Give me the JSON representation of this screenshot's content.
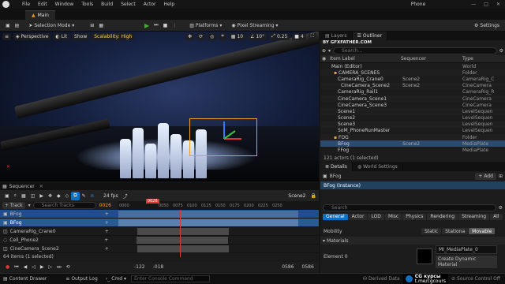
{
  "app": {
    "logo": "unreal-logo",
    "level_tab": "Main",
    "project": "Phone"
  },
  "menu": [
    "File",
    "Edit",
    "Window",
    "Tools",
    "Build",
    "Select",
    "Actor",
    "Help"
  ],
  "toolbar": {
    "mode": "Selection Mode",
    "platforms": "Platforms",
    "pixel_streaming": "Pixel Streaming",
    "settings": "Settings"
  },
  "viewport": {
    "perspective": "Perspective",
    "lit": "Lit",
    "show": "Show",
    "scalability": "Scalability: High",
    "snap_grid": "10",
    "snap_rot": "10°",
    "snap_scale": "0.25",
    "cam_speed": "4"
  },
  "outliner": {
    "tabs": [
      "Layers",
      "Outliner"
    ],
    "watermark": "BY GFXFATHER.COM",
    "search_placeholder": "Search...",
    "columns": [
      "Item Label",
      "Sequencer",
      "Type"
    ],
    "rows": [
      {
        "label": "Main (Editor)",
        "seq": "",
        "type": "World"
      },
      {
        "label": "CAMERA_SCENES",
        "seq": "",
        "type": "Folder"
      },
      {
        "label": "CameraRig_Crane0",
        "seq": "Scene2",
        "type": "CameraRig_C"
      },
      {
        "label": "CineCamera_Scene2",
        "seq": "Scene2",
        "type": "CineCamera"
      },
      {
        "label": "CameraRig_Rail1",
        "seq": "",
        "type": "CameraRig_R"
      },
      {
        "label": "CineCamera_Scene1",
        "seq": "",
        "type": "CineCamera"
      },
      {
        "label": "CineCamera_Scene3",
        "seq": "",
        "type": "CineCamera"
      },
      {
        "label": "Scene1",
        "seq": "",
        "type": "LevelSequen"
      },
      {
        "label": "Scene2",
        "seq": "",
        "type": "LevelSequen"
      },
      {
        "label": "Scene3",
        "seq": "",
        "type": "LevelSequen"
      },
      {
        "label": "SoM_PhoneRunMaster",
        "seq": "",
        "type": "LevelSequen"
      },
      {
        "label": "FOG",
        "seq": "",
        "type": "Folder"
      },
      {
        "label": "BFog",
        "seq": "Scene2",
        "type": "MediaPlate"
      },
      {
        "label": "FFog",
        "seq": "",
        "type": "MediaPlate"
      }
    ],
    "footer": "121 actors (1 selected)"
  },
  "details": {
    "tabs": [
      "Details",
      "World Settings"
    ],
    "actor": "BFog",
    "add_label": "+ Add",
    "component": "BFog (Instance)",
    "search_placeholder": "Search",
    "filters": [
      "General",
      "Actor",
      "LOD",
      "Misc",
      "Physics",
      "Rendering",
      "Streaming",
      "All"
    ],
    "mobility_label": "Mobility",
    "mobility_options": [
      "Static",
      "Stationa",
      "Movable"
    ],
    "section": "Materials",
    "element_label": "Element 0",
    "material_name": "MI_MediaPlate_0",
    "create_dynamic": "Create Dynamic Material"
  },
  "sequencer": {
    "title": "Sequencer",
    "fps": "24 fps",
    "scene": "Scene2",
    "add_track": "+ Track",
    "search_placeholder": "Search Tracks",
    "current_frame": "0026",
    "timeline_marks": [
      "0000",
      "0026",
      "0050",
      "0075",
      "0100",
      "0125",
      "0150",
      "0175",
      "0200",
      "0225",
      "0250"
    ],
    "tracks": [
      "BFog",
      "BFog",
      "CameraRig_Crane0",
      "Cell_Phone2",
      "CineCamera_Scene2"
    ],
    "items_count": "64 items (1 selected)",
    "range_start": "-122",
    "range_in": "-018",
    "range_out": "0586",
    "range_end": "0586"
  },
  "statusbar": {
    "content_drawer": "Content Drawer",
    "output_log": "Output Log",
    "cmd": "Cmd",
    "console_placeholder": "Enter Console Command",
    "derived_data": "Derived Data",
    "watermark_title": "CG курсы",
    "watermark_url": "t.me/cgcours",
    "source_control": "Source Control Off"
  },
  "colors": {
    "accent": "#0e70c0",
    "select": "#1d4f8c",
    "play": "#3fae2a",
    "frame": "#d83a3a"
  }
}
